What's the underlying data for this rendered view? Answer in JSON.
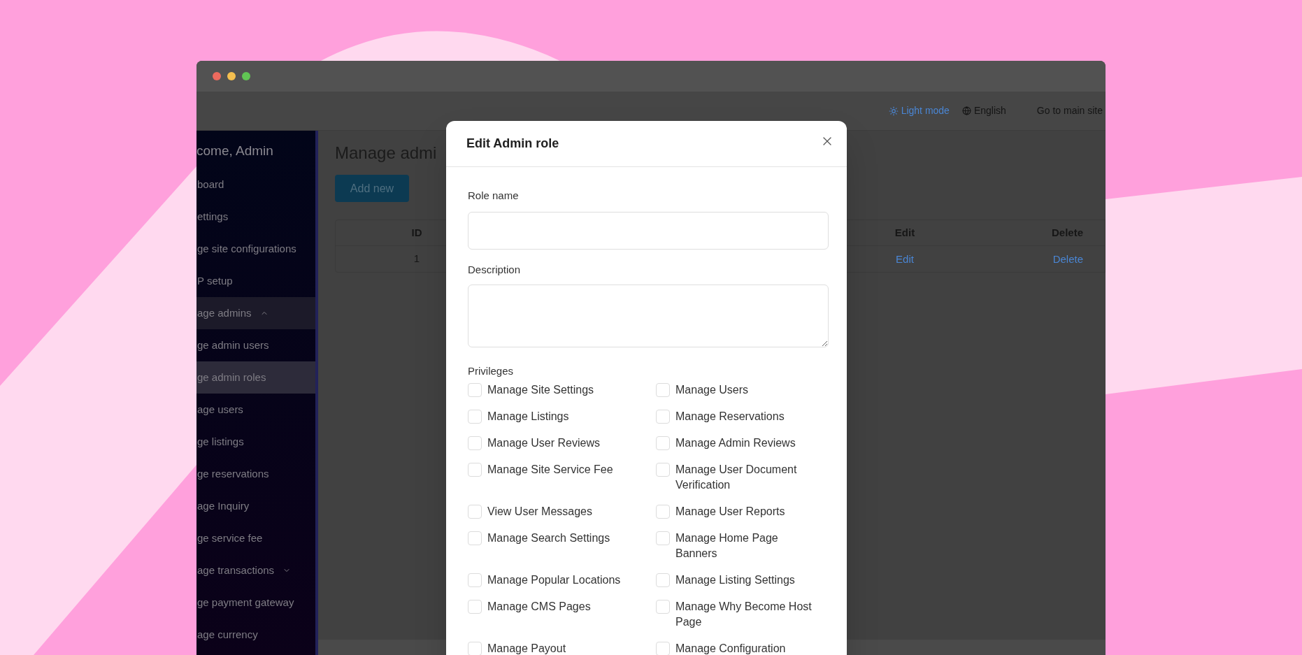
{
  "top_bar": {
    "items": [
      {
        "kind": "theme",
        "label": "Light mode"
      },
      {
        "kind": "language",
        "label": "English"
      },
      {
        "kind": "link",
        "label": "Go to main site"
      }
    ]
  },
  "sidebar": {
    "greeting": "come, Admin",
    "items": [
      {
        "label": "board",
        "selected": false
      },
      {
        "label": "ettings",
        "selected": false
      },
      {
        "label": "ge site configurations",
        "selected": false
      },
      {
        "label": "P setup",
        "selected": false
      },
      {
        "label": "age admins",
        "selected": false,
        "expanded": true,
        "children": [
          {
            "label": "ge admin users",
            "selected": false
          },
          {
            "label": "ge admin roles",
            "selected": true
          }
        ]
      },
      {
        "label": "age users",
        "selected": false
      },
      {
        "label": "ge listings",
        "selected": false
      },
      {
        "label": "ge reservations",
        "selected": false
      },
      {
        "label": "age Inquiry",
        "selected": false
      },
      {
        "label": "ge service fee",
        "selected": false
      },
      {
        "label": "age transactions",
        "selected": false,
        "expanded": false
      },
      {
        "label": "ge payment gateway",
        "selected": false
      },
      {
        "label": "age currency",
        "selected": false
      }
    ]
  },
  "page": {
    "title": "Manage admi",
    "add_button": "Add new",
    "table": {
      "columns": [
        "ID",
        "Edit",
        "Delete"
      ],
      "rows": [
        {
          "cells": [
            "1",
            "Edit",
            "Delete"
          ]
        }
      ]
    }
  },
  "modal": {
    "title": "Edit Admin role",
    "fields": [
      {
        "kind": "input",
        "label": "Role name"
      },
      {
        "kind": "textarea",
        "label": "Description"
      }
    ],
    "privileges": {
      "label": "Privileges",
      "items": [
        {
          "label": "Manage Site Settings",
          "checked": false
        },
        {
          "label": "Manage Users",
          "checked": false
        },
        {
          "label": "Manage Listings",
          "checked": false
        },
        {
          "label": "Manage Reservations",
          "checked": false
        },
        {
          "label": "Manage User Reviews",
          "checked": false
        },
        {
          "label": "Manage Admin Reviews",
          "checked": false
        },
        {
          "label": "Manage Site Service Fee",
          "checked": false
        },
        {
          "label": "Manage User Document Verification",
          "checked": false
        },
        {
          "label": "View User Messages",
          "checked": false
        },
        {
          "label": "Manage User Reports",
          "checked": false
        },
        {
          "label": "Manage Search Settings",
          "checked": false
        },
        {
          "label": "Manage Home Page Banners",
          "checked": false
        },
        {
          "label": "Manage Popular Locations",
          "checked": false
        },
        {
          "label": "Manage Listing Settings",
          "checked": false
        },
        {
          "label": "Manage CMS Pages",
          "checked": false
        },
        {
          "label": "Manage Why Become Host Page",
          "checked": false
        },
        {
          "label": "Manage Payout",
          "checked": false
        },
        {
          "label": "Manage Configuration",
          "checked": false
        }
      ]
    }
  }
}
